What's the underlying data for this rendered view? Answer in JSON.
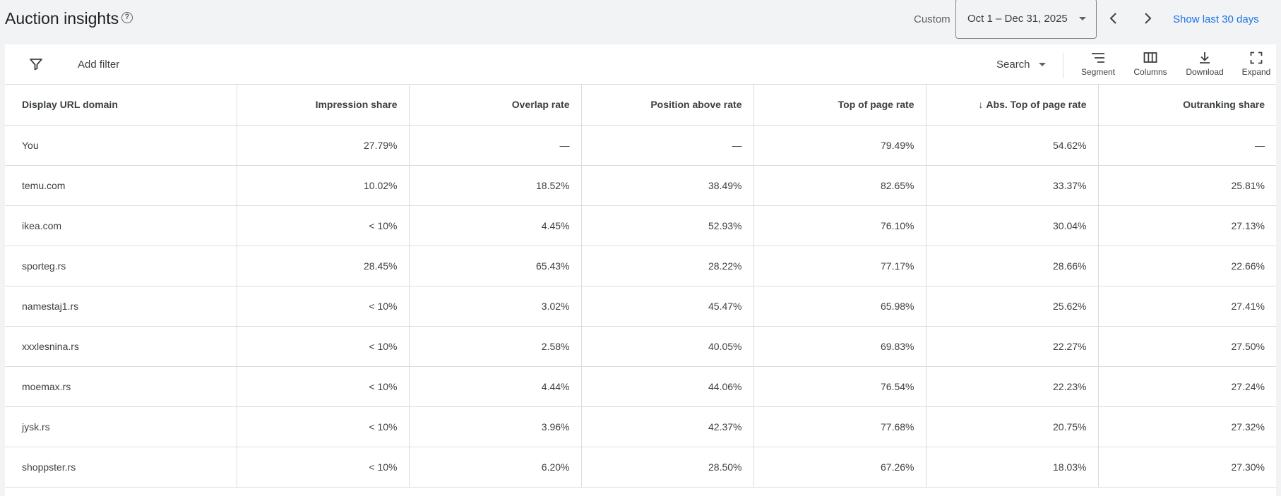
{
  "header": {
    "title": "Auction insights",
    "custom_label": "Custom",
    "date_range": "Oct 1 – Dec 31, 2025",
    "show_last": "Show last 30 days"
  },
  "toolbar": {
    "add_filter": "Add filter",
    "search_label": "Search",
    "segment": "Segment",
    "columns": "Columns",
    "download": "Download",
    "expand": "Expand"
  },
  "table": {
    "headers": [
      "Display URL domain",
      "Impression share",
      "Overlap rate",
      "Position above rate",
      "Top of page rate",
      "Abs. Top of page rate",
      "Outranking share"
    ],
    "sorted_column": "Abs. Top of page rate",
    "rows": [
      [
        "You",
        "27.79%",
        "—",
        "—",
        "79.49%",
        "54.62%",
        "—"
      ],
      [
        "temu.com",
        "10.02%",
        "18.52%",
        "38.49%",
        "82.65%",
        "33.37%",
        "25.81%"
      ],
      [
        "ikea.com",
        "< 10%",
        "4.45%",
        "52.93%",
        "76.10%",
        "30.04%",
        "27.13%"
      ],
      [
        "sporteg.rs",
        "28.45%",
        "65.43%",
        "28.22%",
        "77.17%",
        "28.66%",
        "22.66%"
      ],
      [
        "namestaj1.rs",
        "< 10%",
        "3.02%",
        "45.47%",
        "65.98%",
        "25.62%",
        "27.41%"
      ],
      [
        "xxxlesnina.rs",
        "< 10%",
        "2.58%",
        "40.05%",
        "69.83%",
        "22.27%",
        "27.50%"
      ],
      [
        "moemax.rs",
        "< 10%",
        "4.44%",
        "44.06%",
        "76.54%",
        "22.23%",
        "27.24%"
      ],
      [
        "jysk.rs",
        "< 10%",
        "3.96%",
        "42.37%",
        "77.68%",
        "20.75%",
        "27.32%"
      ],
      [
        "shoppster.rs",
        "< 10%",
        "6.20%",
        "28.50%",
        "67.26%",
        "18.03%",
        "27.30%"
      ]
    ]
  },
  "colors": {
    "accent": "#1a73e8",
    "background": "#f1f3f4",
    "border": "#dadce0"
  },
  "icons": [
    "help-icon",
    "filter-icon",
    "chevron-left-icon",
    "chevron-right-icon",
    "segment-icon",
    "columns-icon",
    "download-icon",
    "expand-icon",
    "arrow-down-icon"
  ]
}
